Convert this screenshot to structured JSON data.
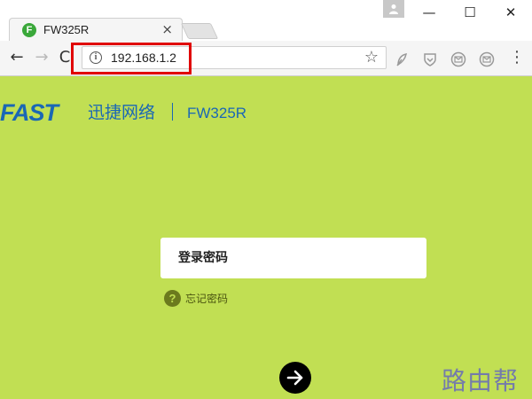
{
  "browser": {
    "tab": {
      "favicon_letter": "F",
      "title": "FW325R",
      "close_glyph": "×"
    },
    "window_controls": {
      "minimize": "—",
      "maximize": "☐",
      "close": "✕"
    },
    "toolbar": {
      "back": "←",
      "forward": "→",
      "reload": "C",
      "address": "192.168.1.2",
      "info_glyph": "i",
      "bookmark_glyph": "☆",
      "menu_glyph": "⋮"
    },
    "icons": [
      "info-icon",
      "star-icon",
      "profile-icon",
      "menu-icon"
    ]
  },
  "page": {
    "brand": {
      "logo": "FAST",
      "chinese_name": "迅捷网络",
      "model": "FW325R"
    },
    "login": {
      "password_placeholder": "登录密码",
      "forgot_password": "忘记密码",
      "help_glyph": "?"
    },
    "watermark": "路由帮"
  },
  "colors": {
    "page_background": "#c1df53",
    "brand_blue": "#1a67b5",
    "highlight_red": "#e00000",
    "login_button": "#000000"
  }
}
